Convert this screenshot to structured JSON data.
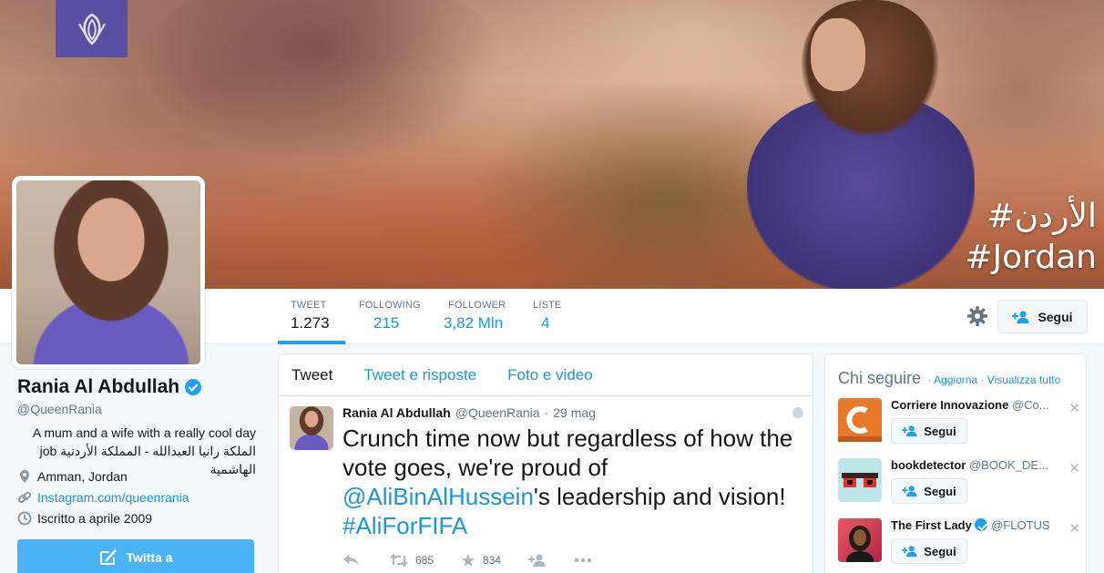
{
  "banner": {
    "hashtag_arabic": "#الأردن",
    "hashtag_latin": "#Jordan"
  },
  "nav": {
    "stats": [
      {
        "label": "TWEET",
        "value": "1.273",
        "active": true
      },
      {
        "label": "FOLLOWING",
        "value": "215"
      },
      {
        "label": "FOLLOWER",
        "value": "3,82 Mln"
      },
      {
        "label": "LISTE",
        "value": "4"
      }
    ],
    "follow_label": "Segui"
  },
  "profile": {
    "name": "Rania Al Abdullah",
    "handle": "@QueenRania",
    "bio_line1": "A mum and a wife with a really cool day",
    "bio_line2": "job الملكة رانيا العبدالله - المملكة الأردنية الهاشمية",
    "location": "Amman, Jordan",
    "link": "Instagram.com/queenrania",
    "joined": "Iscritto a aprile 2009",
    "tweet_to_label": "Twitta a"
  },
  "timeline": {
    "tabs": [
      "Tweet",
      "Tweet e risposte",
      "Foto e video"
    ],
    "tweet": {
      "name": "Rania Al Abdullah",
      "handle": "@QueenRania",
      "sep": "·",
      "date": "29 mag",
      "text_plain": "Crunch time now but regardless of how the vote goes, we're proud of ",
      "text_mention": "@AliBinAlHussein",
      "text_after": "'s leadership and vision! ",
      "text_hashtag": "#AliForFIFA",
      "retweets": "685",
      "likes": "834"
    }
  },
  "who_to_follow": {
    "title": "Chi seguire",
    "sep1": "·",
    "refresh": "Aggiorna",
    "sep2": "·",
    "view_all": "Visualizza tutto",
    "follow_label": "Segui",
    "items": [
      {
        "name": "Corriere Innovazione",
        "handle": "@Co...",
        "pic_color": "#e8782a",
        "pic_caption": "INNOVAZIONE"
      },
      {
        "name": "bookdetector",
        "handle": "@BOOK_DE...",
        "pic_color": "#bfe6e6"
      },
      {
        "name": "The First Lady",
        "handle": "@FLOTUS",
        "verified": true,
        "pic_color": "#c8364a"
      }
    ]
  }
}
